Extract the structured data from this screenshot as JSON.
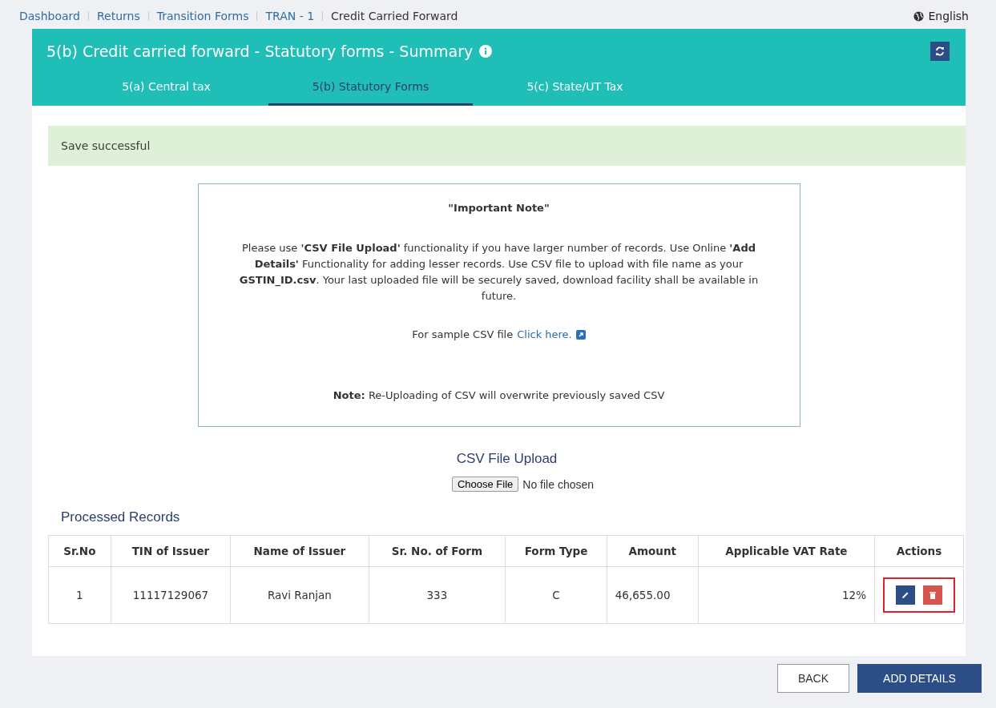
{
  "breadcrumb": [
    {
      "label": "Dashboard",
      "link": true
    },
    {
      "label": "Returns",
      "link": true
    },
    {
      "label": "Transition Forms",
      "link": true
    },
    {
      "label": "TRAN - 1",
      "link": true
    },
    {
      "label": "Credit Carried Forward",
      "link": false
    }
  ],
  "language": "English",
  "header": {
    "title": "5(b) Credit carried forward - Statutory forms - Summary"
  },
  "tabs": [
    {
      "label": "5(a) Central tax",
      "selected": false
    },
    {
      "label": "5(b) Statutory Forms",
      "selected": true
    },
    {
      "label": "5(c) State/UT Tax",
      "selected": false
    }
  ],
  "alert": "Save successful",
  "note": {
    "title": "\"Important Note\"",
    "body": "Please use **'CSV File Upload'** functionality if you have larger number of records. Use Online **'Add Details'** Functionality for adding lesser records. Use CSV file to upload with file name as your **GSTIN_ID.csv**. Your last uploaded file will be securely saved, download facility shall be available in future.",
    "sample_text": "For sample CSV file",
    "sample_link": "Click here.",
    "footer": "**Note:** Re-Uploading of CSV will overwrite previously saved CSV"
  },
  "upload": {
    "title": "CSV File Upload",
    "button": "Choose File",
    "status": "No file chosen"
  },
  "table": {
    "title": "Processed Records",
    "columns": [
      "Sr.No",
      "TIN of Issuer",
      "Name of Issuer",
      "Sr. No. of Form",
      "Form Type",
      "Amount",
      "Applicable VAT Rate",
      "Actions"
    ],
    "rows": [
      {
        "cells": [
          "1",
          "11117129067",
          "Ravi Ranjan",
          "333",
          "C",
          "46,655.00",
          "12%"
        ]
      }
    ]
  },
  "buttons": [
    {
      "label": "BACK",
      "kind": "secondary"
    },
    {
      "label": "ADD DETAILS",
      "kind": "primary"
    }
  ]
}
